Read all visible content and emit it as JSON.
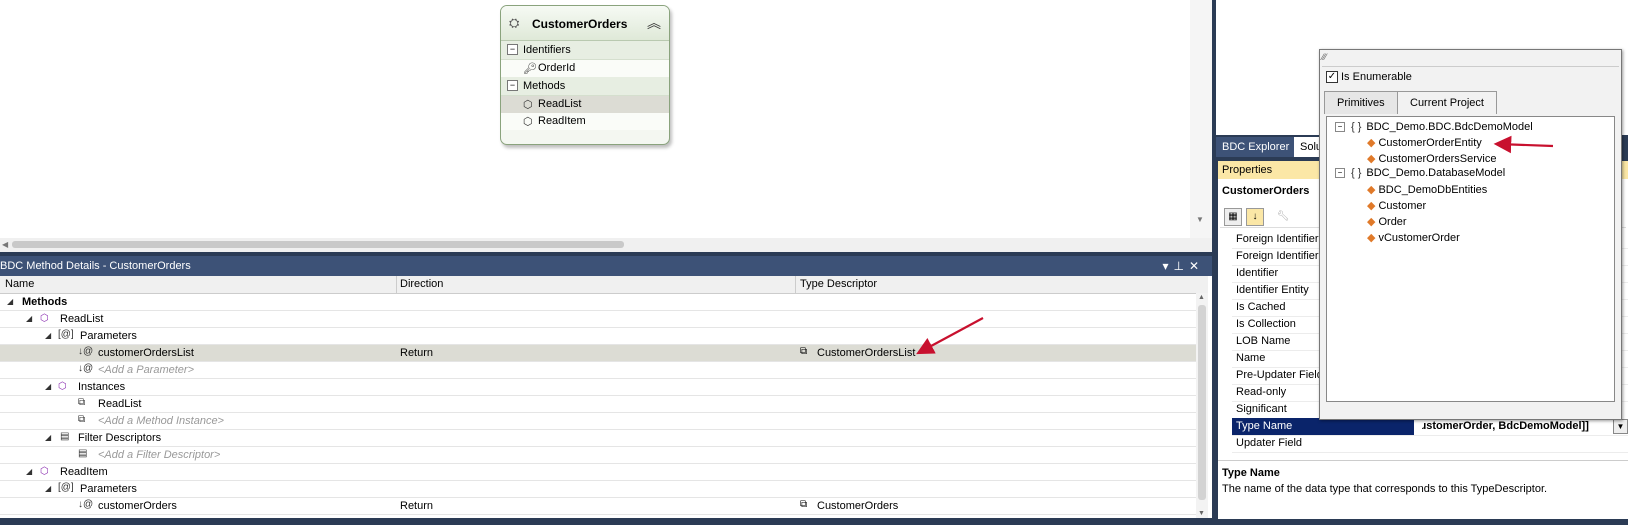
{
  "entity": {
    "title": "CustomerOrders",
    "identifiers_label": "Identifiers",
    "identifiers": [
      "OrderId"
    ],
    "methods_label": "Methods",
    "methods": [
      "ReadList",
      "ReadItem"
    ]
  },
  "method_details": {
    "title": "BDC Method Details - CustomerOrders",
    "columns": {
      "name": "Name",
      "direction": "Direction",
      "type": "Type Descriptor"
    },
    "rows": [
      {
        "name": "Methods",
        "direction": "",
        "type": ""
      },
      {
        "name": "ReadList",
        "direction": "",
        "type": ""
      },
      {
        "name": "Parameters",
        "direction": "",
        "type": ""
      },
      {
        "name": "customerOrdersList",
        "direction": "Return",
        "type": "CustomerOrdersList"
      },
      {
        "name": "<Add a Parameter>",
        "direction": "",
        "type": ""
      },
      {
        "name": "Instances",
        "direction": "",
        "type": ""
      },
      {
        "name": "ReadList",
        "direction": "",
        "type": ""
      },
      {
        "name": "<Add a Method Instance>",
        "direction": "",
        "type": ""
      },
      {
        "name": "Filter Descriptors",
        "direction": "",
        "type": ""
      },
      {
        "name": "<Add a Filter Descriptor>",
        "direction": "",
        "type": ""
      },
      {
        "name": "ReadItem",
        "direction": "",
        "type": ""
      },
      {
        "name": "Parameters",
        "direction": "",
        "type": ""
      },
      {
        "name": "customerOrders",
        "direction": "Return",
        "type": "CustomerOrders"
      }
    ]
  },
  "tabs": {
    "bdc_explorer": "BDC Explorer",
    "solution": "Solu"
  },
  "properties": {
    "title": "Properties",
    "object": "CustomerOrders",
    "rows": [
      "Foreign Identifier",
      "Foreign Identifier",
      "Identifier",
      "Identifier Entity",
      "Is Cached",
      "Is Collection",
      "LOB Name",
      "Name",
      "Pre-Updater Field",
      "Read-only",
      "Significant",
      "Type Name",
      "Updater Field"
    ],
    "type_name_value": "ɹstomerOrder, BdcDemoModel]]",
    "desc_title": "Type Name",
    "desc_text": "The name of the data type that corresponds to this TypeDescriptor."
  },
  "popup": {
    "checkbox_label": "Is Enumerable",
    "tab_primitives": "Primitives",
    "tab_current": "Current Project",
    "ns1": "BDC_Demo.BDC.BdcDemoModel",
    "ns1_items": [
      "CustomerOrderEntity",
      "CustomerOrdersService"
    ],
    "ns2": "BDC_Demo.DatabaseModel",
    "ns2_items": [
      "BDC_DemoDbEntities",
      "Customer",
      "Order",
      "vCustomerOrder"
    ]
  },
  "colors": {
    "accent_red": "#c8102e",
    "panel_title": "#3d5277",
    "selection": "#0a246a"
  }
}
